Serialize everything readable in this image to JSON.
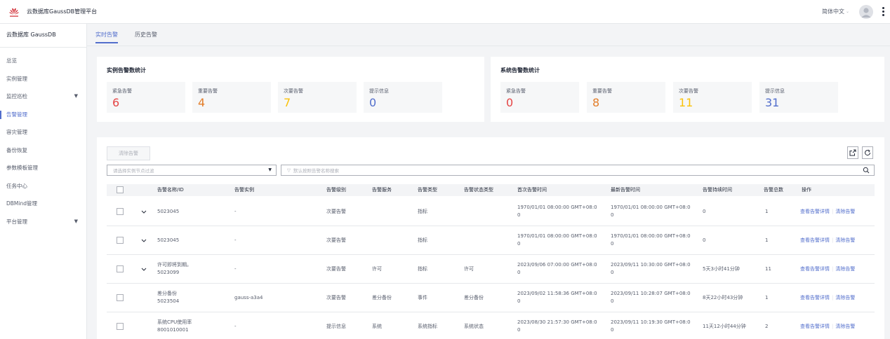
{
  "header": {
    "app_title": "云数据库GaussDB管理平台",
    "language": "简体中文"
  },
  "sidebar": {
    "title": "云数据库 GaussDB",
    "items": [
      {
        "label": "总览"
      },
      {
        "label": "实例管理"
      },
      {
        "label": "监控巡检"
      },
      {
        "label": "告警管理"
      },
      {
        "label": "容灾管理"
      },
      {
        "label": "备份恢复"
      },
      {
        "label": "参数模板管理"
      },
      {
        "label": "任务中心"
      },
      {
        "label": "DBMind管理"
      },
      {
        "label": "平台管理"
      }
    ]
  },
  "tabs": [
    {
      "label": "实时告警"
    },
    {
      "label": "历史告警"
    }
  ],
  "instance_stats": {
    "title": "实例告警数统计",
    "items": [
      {
        "label": "紧急告警",
        "value": "6"
      },
      {
        "label": "重要告警",
        "value": "4"
      },
      {
        "label": "次要告警",
        "value": "7"
      },
      {
        "label": "提示信息",
        "value": "0"
      }
    ]
  },
  "system_stats": {
    "title": "系统告警数统计",
    "items": [
      {
        "label": "紧急告警",
        "value": "0"
      },
      {
        "label": "重要告警",
        "value": "8"
      },
      {
        "label": "次要告警",
        "value": "11"
      },
      {
        "label": "提示信息",
        "value": "31"
      }
    ]
  },
  "colors": {
    "urgent": "#e54545",
    "major": "#e37d29",
    "minor": "#fac20a",
    "info": "#526ecc",
    "accent": "#526ecc"
  },
  "toolbar": {
    "clear_label": "清除告警",
    "node_filter_placeholder": "请选择实例节点过滤",
    "search_placeholder": "默认按照告警名称搜索"
  },
  "table": {
    "columns": [
      "告警名称/ID",
      "告警实例",
      "告警级别",
      "告警服务",
      "告警类型",
      "告警状态类型",
      "首次告警时间",
      "最新告警时间",
      "告警持续时间",
      "告警总数",
      "操作"
    ],
    "rows": [
      {
        "name": "",
        "id": "5023045",
        "instance": "-",
        "level": "次要告警",
        "service": "",
        "type": "指标",
        "state": "",
        "first1": "1970/01/01 08:00:00 GMT+08:0",
        "first2": "0",
        "last1": "1970/01/01 08:00:00 GMT+08:0",
        "last2": "0",
        "duration": "0",
        "total": "1"
      },
      {
        "name": "",
        "id": "5023045",
        "instance": "-",
        "level": "次要告警",
        "service": "",
        "type": "指标",
        "state": "",
        "first1": "1970/01/01 08:00:00 GMT+08:0",
        "first2": "0",
        "last1": "1970/01/01 08:00:00 GMT+08:0",
        "last2": "0",
        "duration": "0",
        "total": "1"
      },
      {
        "name": "许可即将到期。",
        "id": "5023099",
        "instance": "-",
        "level": "次要告警",
        "service": "许可",
        "type": "指标",
        "state": "许可",
        "first1": "2023/09/06 07:00:00 GMT+08:0",
        "first2": "0",
        "last1": "2023/09/11 10:30:00 GMT+08:0",
        "last2": "0",
        "duration": "5天3小时41分钟",
        "total": "11"
      },
      {
        "name": "差分备份",
        "id": "5023504",
        "instance": "gauss-a3a4",
        "level": "次要告警",
        "service": "差分备份",
        "type": "事件",
        "state": "差分备份",
        "first1": "2023/09/02 11:58:36 GMT+08:0",
        "first2": "0",
        "last1": "2023/09/11 10:28:07 GMT+08:0",
        "last2": "0",
        "duration": "8天22小时43分钟",
        "total": "1"
      },
      {
        "name": "系统CPU使用率",
        "id": "8001010001",
        "instance": "-",
        "level": "提示信息",
        "service": "系统",
        "type": "系统指标",
        "state": "系统状态",
        "first1": "2023/08/30 21:57:30 GMT+08:0",
        "first2": "0",
        "last1": "2023/09/11 10:19:30 GMT+08:0",
        "last2": "0",
        "duration": "11天12小时44分钟",
        "total": "2"
      }
    ],
    "op_detail": "查看告警详情",
    "op_clear": "清除告警"
  }
}
